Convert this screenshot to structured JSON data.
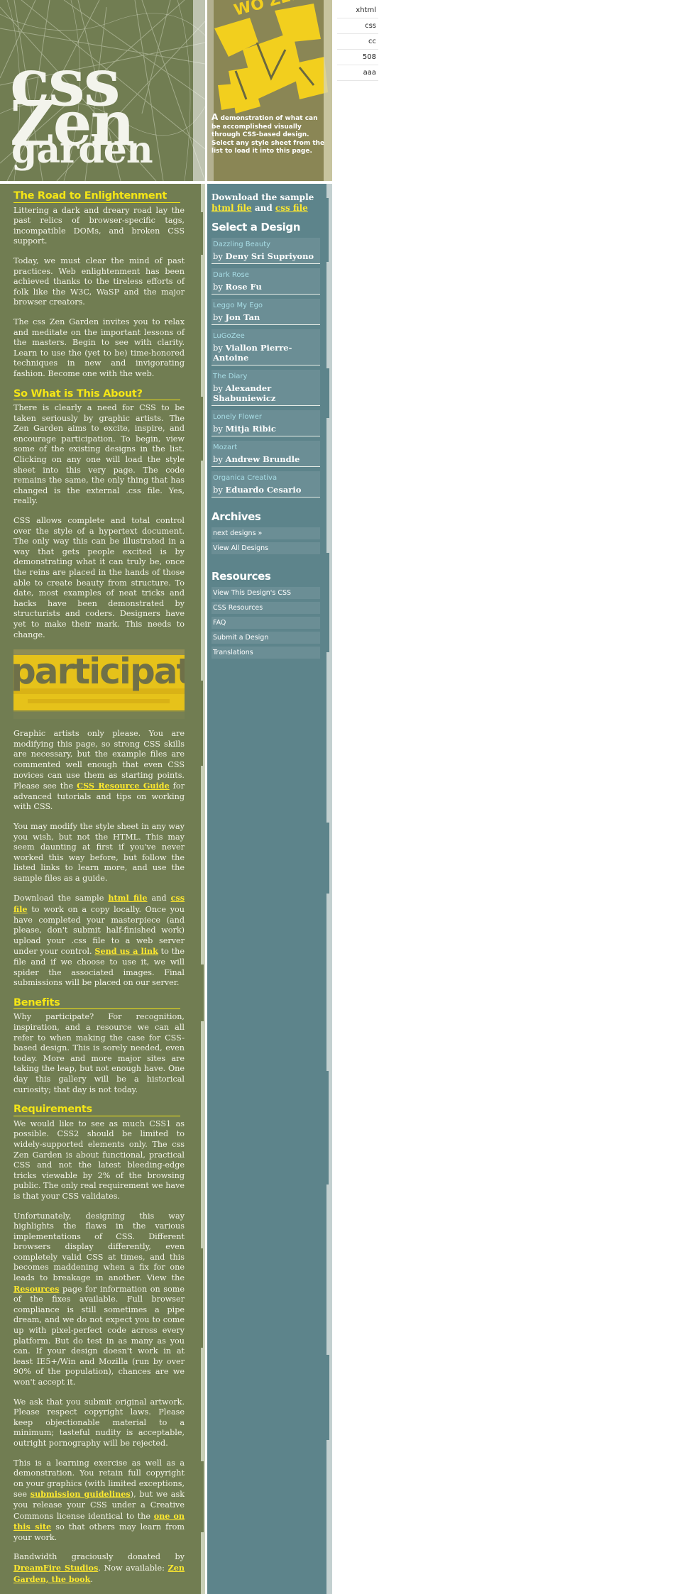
{
  "header": {
    "logo": {
      "css": "css",
      "zen": "Zen",
      "garden": "garden"
    },
    "summary_first_letter": "A",
    "summary_rest": "demonstration of what can be accomplished visually through CSS-based design. Select any style sheet from the list to load it into this page.",
    "deco_art_text": "WO ZEN"
  },
  "right_nav": [
    "xhtml",
    "css",
    "cc",
    "508",
    "aaa"
  ],
  "main": {
    "sections": [
      {
        "title": "The Road to Enlightenment",
        "paragraphs": [
          "Littering a dark and dreary road lay the past relics of browser-specific tags, incompatible DOMs, and broken CSS support.",
          "Today, we must clear the mind of past practices. Web enlightenment has been achieved thanks to the tireless efforts of folk like the W3C, WaSP and the major browser creators.",
          "The css Zen Garden invites you to relax and meditate on the important lessons of the masters. Begin to see with clarity. Learn to use the (yet to be) time-honored techniques in new and invigorating fashion. Become one with the web."
        ]
      },
      {
        "title": "So What is This About?",
        "p1": "There is clearly a need for CSS to be taken seriously by graphic artists. The Zen Garden aims to excite, inspire, and encourage participation. To begin, view some of the existing designs in the list. Clicking on any one will load the style sheet into this very page. The code remains the same, the only thing that has changed is the external .css file. Yes, really.",
        "p2": "CSS allows complete and total control over the style of a hypertext document. The only way this can be illustrated in a way that gets people excited is by demonstrating what it can truly be, once the reins are placed in the hands of those able to create beauty from structure. To date, most examples of neat tricks and hacks have been demonstrated by structurists and coders. Designers have yet to make their mark. This needs to change."
      },
      {
        "participate_image_text": "participate",
        "p3_a": "Graphic artists only please. You are modifying this page, so strong CSS skills are necessary, but the example files are commented well enough that even CSS novices can use them as starting points. Please see the ",
        "p3_link": "CSS Resource Guide",
        "p3_b": " for advanced tutorials and tips on working with CSS.",
        "p4": "You may modify the style sheet in any way you wish, but not the HTML. This may seem daunting at first if you've never worked this way before, but follow the listed links to learn more, and use the sample files as a guide.",
        "p5_a": "Download the sample ",
        "p5_link1": "html file",
        "p5_and": " and ",
        "p5_link2": "css file",
        "p5_b": " to work on a copy locally. Once you have completed your masterpiece (and please, don't submit half-finished work) upload your .css file to a web server under your control. ",
        "p5_link3": "Send us a link",
        "p5_c": " to the file and if we choose to use it, we will spider the associated images. Final submissions will be placed on our server."
      },
      {
        "title": "Benefits",
        "p1": "Why participate? For recognition, inspiration, and a resource we can all refer to when making the case for CSS-based design. This is sorely needed, even today. More and more major sites are taking the leap, but not enough have. One day this gallery will be a historical curiosity; that day is not today."
      },
      {
        "title": "Requirements",
        "p1": "We would like to see as much CSS1 as possible. CSS2 should be limited to widely-supported elements only. The css Zen Garden is about functional, practical CSS and not the latest bleeding-edge tricks viewable by 2% of the browsing public. The only real requirement we have is that your CSS validates.",
        "p2_a": "Unfortunately, designing this way highlights the flaws in the various implementations of CSS. Different browsers display differently, even completely valid CSS at times, and this becomes maddening when a fix for one leads to breakage in another. View the ",
        "p2_link": "Resources",
        "p2_b": " page for information on some of the fixes available. Full browser compliance is still sometimes a pipe dream, and we do not expect you to come up with pixel-perfect code across every platform. But do test in as many as you can. If your design doesn't work in at least IE5+/Win and Mozilla (run by over 90% of the population), chances are we won't accept it.",
        "p3": "We ask that you submit original artwork. Please respect copyright laws. Please keep objectionable material to a minimum; tasteful nudity is acceptable, outright pornography will be rejected.",
        "p4_a": "This is a learning exercise as well as a demonstration. You retain full copyright on your graphics (with limited exceptions, see ",
        "p4_link1": "submission guidelines",
        "p4_b": "), but we ask you release your CSS under a Creative Commons license identical to the ",
        "p4_link2": "one on this site",
        "p4_c": " so that others may learn from your work.",
        "p5_a": "Bandwidth graciously donated by ",
        "p5_link1": "DreamFire Studios",
        "p5_b": ". Now available: ",
        "p5_link2": "Zen Garden, the book",
        "p5_c": "."
      }
    ]
  },
  "sidebar": {
    "download_prefix": "Download the sample",
    "download_html": "html file",
    "download_and": "and",
    "download_css": "css file",
    "select_title": "Select a Design",
    "designs": [
      {
        "name": "Dazzling Beauty",
        "by": "by",
        "author": "Deny Sri Supriyono"
      },
      {
        "name": "Dark Rose",
        "by": "by",
        "author": "Rose Fu"
      },
      {
        "name": "Leggo My Ego",
        "by": "by",
        "author": "Jon Tan"
      },
      {
        "name": "LuGoZee",
        "by": "by",
        "author": "Viallon Pierre-Antoine"
      },
      {
        "name": "The Diary",
        "by": "by",
        "author": "Alexander Shabuniewicz"
      },
      {
        "name": "Lonely Flower",
        "by": "by",
        "author": "Mitja Ribic"
      },
      {
        "name": "Mozart",
        "by": "by",
        "author": "Andrew Brundle"
      },
      {
        "name": "Organica Creativa",
        "by": "by",
        "author": "Eduardo Cesario"
      }
    ],
    "archives_title": "Archives",
    "archives": [
      "next designs »",
      "View All Designs"
    ],
    "resources_title": "Resources",
    "resources": [
      "View This Design's CSS",
      "CSS Resources",
      "FAQ",
      "Submit a Design",
      "Translations"
    ]
  },
  "colors": {
    "olive": "#717d52",
    "teal": "#5d848b",
    "teal_light": "#6b8e95",
    "yellow": "#f4e516",
    "design_name": "#a8dde6"
  }
}
